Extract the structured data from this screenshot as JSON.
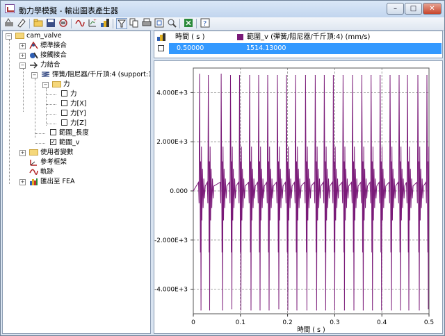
{
  "window": {
    "title": "動力學模擬 - 輸出圖表產生器",
    "controls": [
      "minimize",
      "maximize",
      "close"
    ]
  },
  "toolbar": {
    "icons": [
      "new-graph-icon",
      "erase-icon",
      "open-icon",
      "save-icon",
      "print-setup-icon",
      "curve-icon",
      "zoom-data-icon",
      "chart-color-icon",
      "filter-icon",
      "copy-icon",
      "print-icon",
      "zoom-fit-icon",
      "zoom-icon",
      "export-excel-icon",
      "help-icon"
    ]
  },
  "tree": {
    "root": "cam_valve",
    "items": [
      {
        "label": "標準接合",
        "icon": "standard-joint-icon"
      },
      {
        "label": "接觸接合",
        "icon": "contact-joint-icon"
      },
      {
        "label": "力結合",
        "icon": "force-icon"
      },
      {
        "label": "彈簧/阻尼器/千斤頂:4 (support:1, valve...",
        "icon": "spring-icon"
      },
      {
        "label": "力",
        "icon": "folder-icon"
      },
      {
        "label": "力"
      },
      {
        "label": "力[X]"
      },
      {
        "label": "力[Y]"
      },
      {
        "label": "力[Z]"
      },
      {
        "label": "範圍_長度"
      },
      {
        "label": "範圍_v",
        "checked": true
      },
      {
        "label": "使用者變數",
        "icon": "folder-icon"
      },
      {
        "label": "參考框架",
        "icon": "reference-frame-icon"
      },
      {
        "label": "軌跡",
        "icon": "trace-icon"
      },
      {
        "label": "匯出至 FEA",
        "icon": "fea-export-icon"
      }
    ]
  },
  "legend": {
    "col_time": "時間 ( s )",
    "col_series": "範圍_v (彈簧/阻尼器/千斤頂:4) (mm/s)",
    "row_time": "0.50000",
    "row_value": "1514.13000",
    "series_color": "#7a1a78"
  },
  "chart_data": {
    "type": "line",
    "xlabel": "時間 ( s )",
    "ylabel": "",
    "x_ticks": [
      "0",
      "0.1",
      "0.2",
      "0.3",
      "0.4",
      "0.5"
    ],
    "y_ticks": [
      "4.000E+3",
      "2.000E+3",
      "0.000",
      "-2.000E+3",
      "-4.000E+3"
    ],
    "xlim": [
      0,
      0.5
    ],
    "ylim": [
      -5000,
      5000
    ],
    "grid": true,
    "series": [
      {
        "color": "#7a1a78",
        "peaks": [
          {
            "x": 0.0133,
            "y": 4750
          },
          {
            "x": 0.0163,
            "y": -4850
          },
          {
            "x": 0.0318,
            "y": 4700
          },
          {
            "x": 0.0347,
            "y": -4850
          },
          {
            "x": 0.0592,
            "y": 4750
          },
          {
            "x": 0.0622,
            "y": -4850
          },
          {
            "x": 0.0789,
            "y": 4700
          },
          {
            "x": 0.0818,
            "y": -4800
          },
          {
            "x": 0.0981,
            "y": 4700
          },
          {
            "x": 0.1011,
            "y": -4850
          },
          {
            "x": 0.1195,
            "y": 4700
          },
          {
            "x": 0.1224,
            "y": -4850
          },
          {
            "x": 0.1386,
            "y": 4700
          },
          {
            "x": 0.1416,
            "y": -4850
          },
          {
            "x": 0.1578,
            "y": 4700
          },
          {
            "x": 0.1608,
            "y": -4850
          },
          {
            "x": 0.1785,
            "y": 4700
          },
          {
            "x": 0.1814,
            "y": -4800
          },
          {
            "x": 0.1976,
            "y": 4700
          },
          {
            "x": 0.2006,
            "y": -4850
          },
          {
            "x": 0.2168,
            "y": 4700
          },
          {
            "x": 0.2198,
            "y": -4850
          },
          {
            "x": 0.2381,
            "y": 4700
          },
          {
            "x": 0.241,
            "y": -4850
          },
          {
            "x": 0.2587,
            "y": 4700
          },
          {
            "x": 0.2617,
            "y": -4850
          },
          {
            "x": 0.2779,
            "y": 4700
          },
          {
            "x": 0.2808,
            "y": -4850
          },
          {
            "x": 0.2971,
            "y": 4700
          },
          {
            "x": 0.3,
            "y": -4850
          },
          {
            "x": 0.3177,
            "y": 4700
          },
          {
            "x": 0.3206,
            "y": -4850
          },
          {
            "x": 0.3378,
            "y": 4700
          },
          {
            "x": 0.3407,
            "y": -4850
          },
          {
            "x": 0.3575,
            "y": 4700
          },
          {
            "x": 0.3605,
            "y": -4850
          },
          {
            "x": 0.3771,
            "y": 4700
          },
          {
            "x": 0.3801,
            "y": -4850
          },
          {
            "x": 0.3963,
            "y": 4700
          },
          {
            "x": 0.3993,
            "y": -4850
          },
          {
            "x": 0.4174,
            "y": 4700
          },
          {
            "x": 0.4204,
            "y": -4850
          },
          {
            "x": 0.4366,
            "y": 4700
          },
          {
            "x": 0.4395,
            "y": -4850
          },
          {
            "x": 0.4543,
            "y": 4700
          },
          {
            "x": 0.4572,
            "y": -4850
          },
          {
            "x": 0.4764,
            "y": 4700
          },
          {
            "x": 0.4794,
            "y": -4850
          },
          {
            "x": 0.4956,
            "y": 4700
          },
          {
            "x": 0.4985,
            "y": -4800
          }
        ]
      }
    ]
  }
}
